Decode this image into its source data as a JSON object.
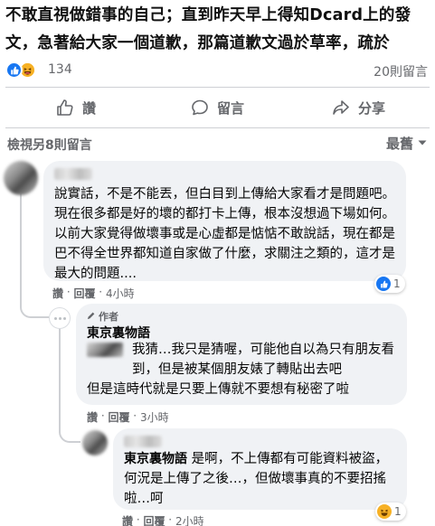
{
  "post": {
    "text": "不敢直視做錯事的自己；直到昨天早上得知Dcard上的發文，急著給大家一個道歉，那篇道歉文過於草率，疏於"
  },
  "reactions": {
    "count": "134",
    "comments_label": "20則留言"
  },
  "actions": {
    "like": "讚",
    "comment": "留言",
    "share": "分享"
  },
  "comments_header": {
    "view_more": "檢視另8則留言",
    "sort": "最舊"
  },
  "comments": [
    {
      "text": "說實話，不是不能丟，但白目到上傳給大家看才是問題吧。現在很多都是好的壞的都打卡上傳，根本沒想過下場如何。以前大家覺得做壞事或是心虛都是惦惦不敢說話，現在都是巴不得全世界都知道自家做了什麼，求關注之類的，這才是最大的問題....",
      "like": "讚",
      "reply": "回覆",
      "time": "4小時",
      "react_count": "1",
      "replies": [
        {
          "badge": "作者",
          "name": "東京裏物語",
          "text1": "我猜…我只是猜喔，可能他自以為只有朋友看到，但是被某個朋友婊了轉貼出去吧",
          "text2": "但是這時代就是只要上傳就不要想有秘密了啦",
          "like": "讚",
          "reply": "回覆",
          "time": "3小時"
        },
        {
          "mention": "東京裏物語",
          "text": "是啊，不上傳都有可能資料被盜，何況是上傳了之後…，但做壞事真的不要招搖啦…呵",
          "like": "讚",
          "reply": "回覆",
          "time": "2小時",
          "react_count": "1"
        }
      ]
    }
  ],
  "colors": {
    "like_blue": "#1877f2",
    "haha_yellow": "#f7b125",
    "bubble_bg": "#f0f2f5",
    "meta_gray": "#65676b"
  },
  "icons": [
    "like-icon",
    "haha-icon",
    "thumbs-up-icon",
    "comment-icon",
    "share-icon",
    "chevron-down-icon",
    "pen-icon"
  ]
}
